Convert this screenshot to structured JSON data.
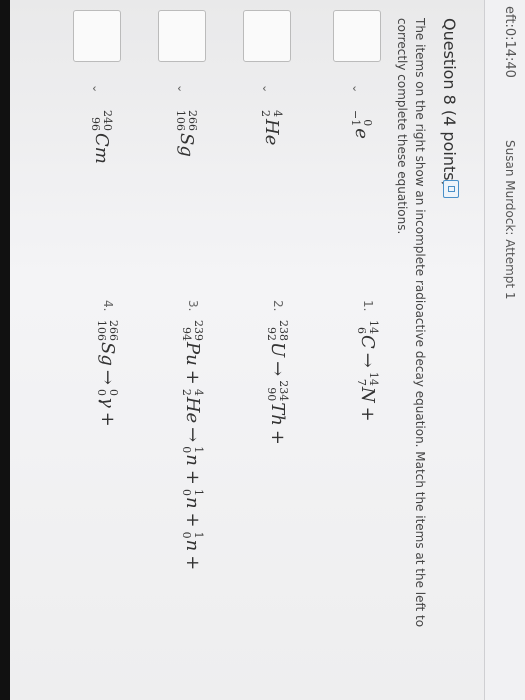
{
  "header": {
    "timer": "eft:0:14:40",
    "attempt": "Susan Murdock: Attempt 1"
  },
  "question": {
    "title": "Question 8 (4 points)",
    "instructions": "The items on the right show an incomplete radioactive decay equation. Match the items at the left to correctly complete these equations."
  },
  "items": [
    {
      "symbol": "e",
      "sup": "0",
      "sub": "−1"
    },
    {
      "symbol": "He",
      "sup": "4",
      "sub": "2"
    },
    {
      "symbol": "Sg",
      "sup": "266",
      "sub": "106"
    },
    {
      "symbol": "Cm",
      "sup": "240",
      "sub": "96"
    }
  ],
  "equations": [
    {
      "num": "1.",
      "terms": [
        {
          "sup": "14",
          "sub": "6",
          "sym": "C"
        },
        {
          "op": "→"
        },
        {
          "sup": "14",
          "sub": "7",
          "sym": "N"
        },
        {
          "op": "+"
        }
      ]
    },
    {
      "num": "2.",
      "terms": [
        {
          "sup": "238",
          "sub": "92",
          "sym": "U"
        },
        {
          "op": "→"
        },
        {
          "sup": "234",
          "sub": "90",
          "sym": "Th"
        },
        {
          "op": "+"
        }
      ]
    },
    {
      "num": "3.",
      "terms": [
        {
          "sup": "239",
          "sub": "94",
          "sym": "Pu"
        },
        {
          "op": "+"
        },
        {
          "sup": "4",
          "sub": "2",
          "sym": "He"
        },
        {
          "op": "→"
        },
        {
          "sup": "1",
          "sub": "0",
          "sym": "n"
        },
        {
          "op": "+"
        },
        {
          "sup": "1",
          "sub": "0",
          "sym": "n"
        },
        {
          "op": "+"
        },
        {
          "sup": "1",
          "sub": "0",
          "sym": "n"
        },
        {
          "op": "+"
        }
      ]
    },
    {
      "num": "4.",
      "terms": [
        {
          "sup": "266",
          "sub": "106",
          "sym": "Sg"
        },
        {
          "op": "→"
        },
        {
          "sup": "0",
          "sub": "0",
          "sym": "γ"
        },
        {
          "op": "+"
        }
      ]
    }
  ],
  "select_caret": "⌄"
}
